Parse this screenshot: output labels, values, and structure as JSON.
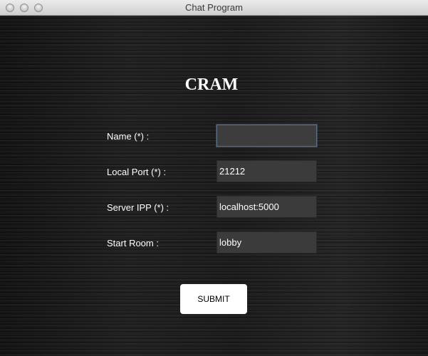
{
  "window": {
    "title": "Chat Program"
  },
  "app": {
    "heading": "CRAM"
  },
  "form": {
    "name": {
      "label": "Name (*) :",
      "value": ""
    },
    "local_port": {
      "label": "Local Port (*) :",
      "value": "21212"
    },
    "server_ipp": {
      "label": "Server IPP (*) :",
      "value": "localhost:5000"
    },
    "start_room": {
      "label": "Start Room :",
      "value": "lobby"
    },
    "submit_label": "SUBMIT"
  },
  "colors": {
    "background": "#1a1a1a",
    "input_background": "#3b3b3b",
    "text": "#ffffff",
    "button_background": "#ffffff"
  }
}
